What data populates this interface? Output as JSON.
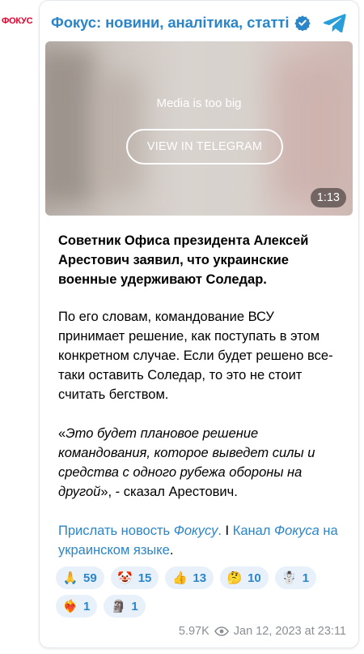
{
  "avatar": {
    "label": "ФОКУС",
    "color": "#e4002b"
  },
  "header": {
    "channel_name": "Фокус: новини, аналітика, статті",
    "verified_icon": "verified-check-icon",
    "logo_icon": "telegram-logo-icon"
  },
  "media": {
    "message": "Media is too big",
    "button_label": "VIEW IN TELEGRAM",
    "duration": "1:13"
  },
  "post": {
    "p1": "Советник Офиса президента Алексей Арестович заявил, что украинские военные удерживают Соледар.",
    "p2": "По его словам, командование ВСУ принимает решение, как поступать в этом конкретном случае. Если будет решено все-таки оставить Соледар, то это не стоит считать бегством.",
    "p3_open": "«",
    "p3_quote": "Это будет плановое решение командования, которое выведет силы и средства с одного рубежа обороны на другой",
    "p3_close": "», - сказал Арестович.",
    "link1_a": "Прислать новость ",
    "link1_b": "Фокусу",
    "link1_c": ".",
    "sep": " I ",
    "link2_a": "Канал ",
    "link2_b": "Фокуса",
    "link2_c": " на украинском языке",
    "link2_end": "."
  },
  "reactions": [
    {
      "emoji": "🙏",
      "icon": "pray-icon",
      "count": "59"
    },
    {
      "emoji": "🤡",
      "icon": "clown-icon",
      "count": "15"
    },
    {
      "emoji": "👍",
      "icon": "thumbs-up-icon",
      "count": "13"
    },
    {
      "emoji": "🤔",
      "icon": "thinking-icon",
      "count": "10"
    },
    {
      "emoji": "☃️",
      "icon": "snowman-icon",
      "count": "1"
    },
    {
      "emoji": "❤️‍🔥",
      "icon": "heart-on-fire-icon",
      "count": "1"
    },
    {
      "emoji": "🗿",
      "icon": "moai-icon",
      "count": "1"
    }
  ],
  "meta": {
    "views": "5.97K",
    "date": "Jan 12, 2023 at 23:11"
  },
  "colors": {
    "accent": "#2a86c9",
    "reaction_bg": "#e8f1fa",
    "meta": "#8a8f94"
  }
}
